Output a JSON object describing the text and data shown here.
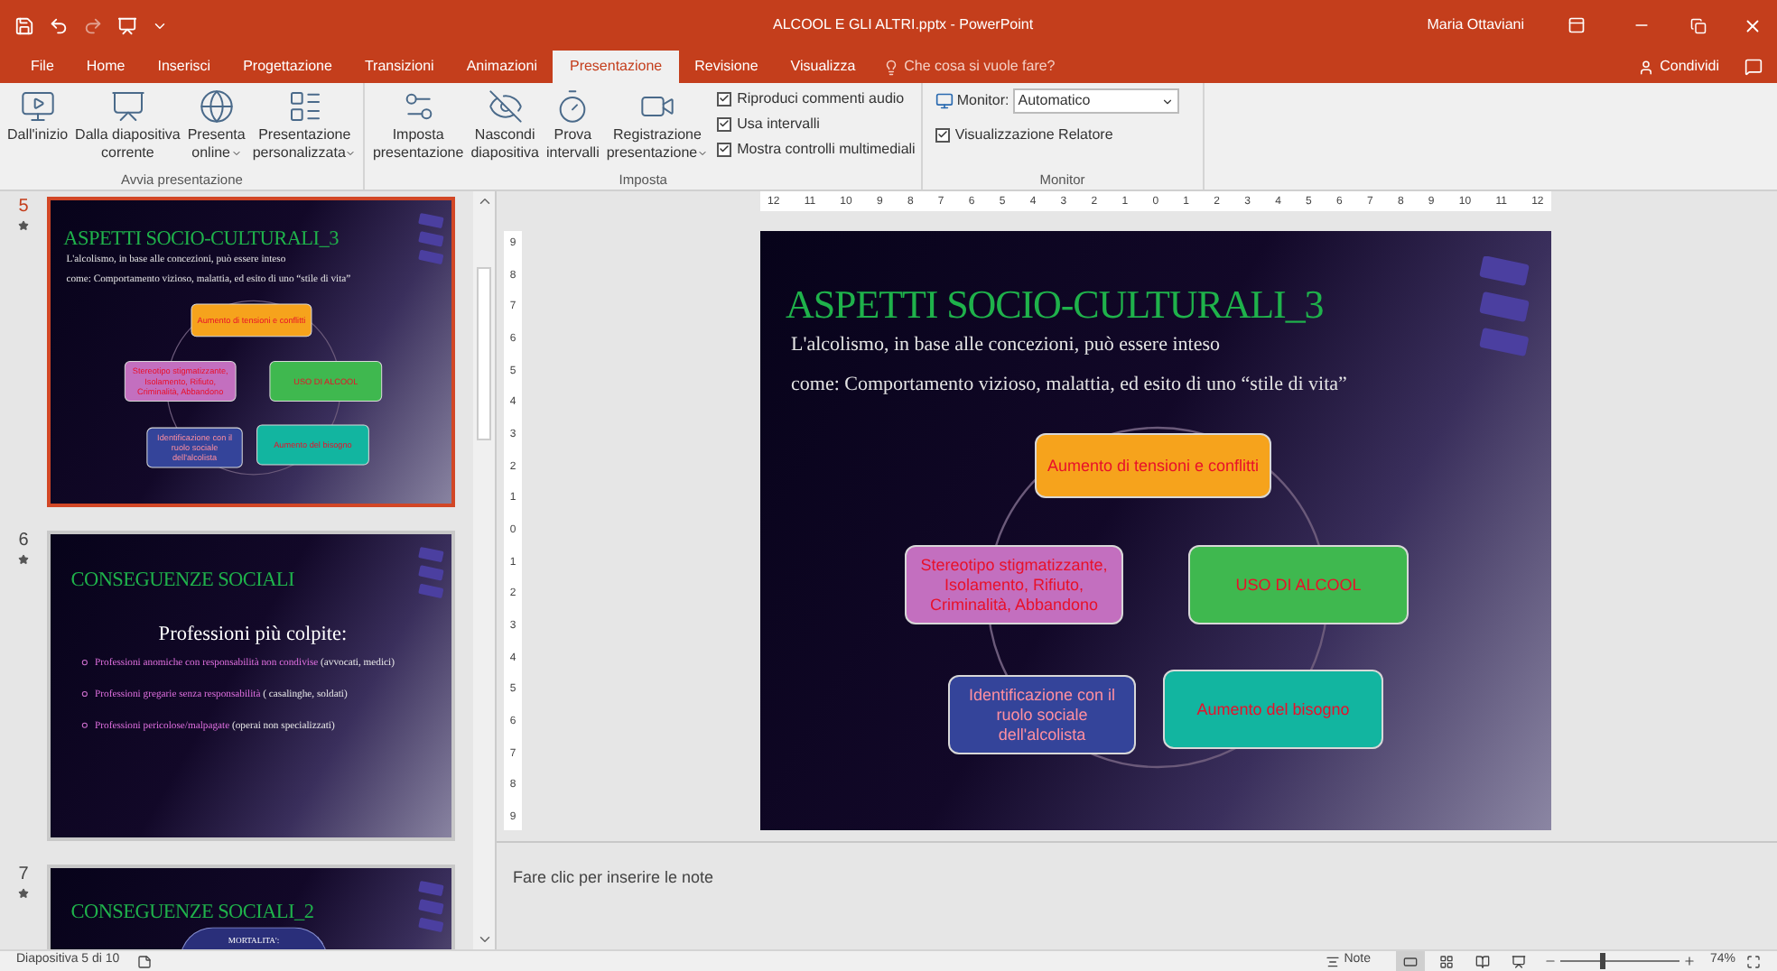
{
  "window": {
    "title": "ALCOOL E GLI ALTRI.pptx - PowerPoint",
    "user": "Maria Ottaviani"
  },
  "tabs": [
    {
      "label": "File",
      "selected": false
    },
    {
      "label": "Home",
      "selected": false
    },
    {
      "label": "Inserisci",
      "selected": false
    },
    {
      "label": "Progettazione",
      "selected": false
    },
    {
      "label": "Transizioni",
      "selected": false
    },
    {
      "label": "Animazioni",
      "selected": false
    },
    {
      "label": "Presentazione",
      "selected": true
    },
    {
      "label": "Revisione",
      "selected": false
    },
    {
      "label": "Visualizza",
      "selected": false
    }
  ],
  "search": {
    "placeholder": "Che cosa si vuole fare?"
  },
  "share": {
    "label": "Condividi"
  },
  "ribbon": {
    "groups": [
      {
        "label": "Avvia presentazione",
        "items": [
          {
            "kind": "large",
            "lines": [
              "Dall'inizio"
            ],
            "dropdown": false
          },
          {
            "kind": "large",
            "lines": [
              "Dalla diapositiva",
              "corrente"
            ],
            "dropdown": false
          },
          {
            "kind": "large",
            "lines": [
              "Presenta",
              "online"
            ],
            "dropdown": true
          },
          {
            "kind": "large",
            "lines": [
              "Presentazione",
              "personalizzata"
            ],
            "dropdown": true
          }
        ]
      },
      {
        "label": "Imposta",
        "items": [
          {
            "kind": "large",
            "lines": [
              "Imposta",
              "presentazione"
            ],
            "dropdown": false
          },
          {
            "kind": "large",
            "lines": [
              "Nascondi",
              "diapositiva"
            ],
            "dropdown": false
          },
          {
            "kind": "large",
            "lines": [
              "Prova",
              "intervalli"
            ],
            "dropdown": false
          },
          {
            "kind": "large",
            "lines": [
              "Registrazione",
              "presentazione"
            ],
            "dropdown": true
          },
          {
            "kind": "checks",
            "checks": [
              {
                "label": "Riproduci commenti audio",
                "checked": true
              },
              {
                "label": "Usa intervalli",
                "checked": true
              },
              {
                "label": "Mostra controlli multimediali",
                "checked": true
              }
            ]
          }
        ]
      },
      {
        "label": "Monitor",
        "items": [
          {
            "kind": "monitor",
            "label": "Monitor:",
            "value": "Automatico",
            "checks": [
              {
                "label": "Visualizzazione Relatore",
                "checked": true
              }
            ]
          }
        ]
      }
    ]
  },
  "slides_panel": {
    "slides": [
      {
        "number": "5",
        "selected": true,
        "kind": "diagram",
        "title": "ASPETTI SOCIO-CULTURALI_3",
        "lines": [
          "L'alcolismo, in base alle concezioni, può essere inteso",
          "come: Comportamento vizioso, malattia, ed esito di uno “stile di vita”"
        ],
        "nodes": [
          {
            "text": "Aumento di tensioni e conflitti",
            "color": "#f6a31c"
          },
          {
            "text": "Stereotipo stigmatizzante, Isolamento, Rifiuto, Criminalità, Abbandono",
            "color": "#c36fbf"
          },
          {
            "text": "USO DI ALCOOL",
            "color": "#3fb84f"
          },
          {
            "text": "Identificazione con il ruolo sociale dell'alcolista",
            "color": "#34449a"
          },
          {
            "text": "Aumento del bisogno",
            "color": "#12b5a0"
          }
        ]
      },
      {
        "number": "6",
        "selected": false,
        "kind": "bullets",
        "title": "CONSEGUENZE SOCIALI",
        "heading": "Professioni più colpite:",
        "bullets": [
          {
            "highlight": "Professioni anomiche con responsabilità non condivise",
            "rest": "(avvocati, medici)"
          },
          {
            "highlight": "Professioni gregarie senza responsabilità",
            "rest": "( casalinghe, soldati)"
          },
          {
            "highlight": "Professioni pericolose/malpagate",
            "rest": "(operai non specializzati)"
          }
        ]
      },
      {
        "number": "7",
        "selected": false,
        "kind": "ellipses",
        "title": "CONSEGUENZE SOCIALI_2",
        "bubble": "MORTALITA':"
      }
    ]
  },
  "ruler": {
    "horizontal": [
      "12",
      "11",
      "10",
      "9",
      "8",
      "7",
      "6",
      "5",
      "4",
      "3",
      "2",
      "1",
      "0",
      "1",
      "2",
      "3",
      "4",
      "5",
      "6",
      "7",
      "8",
      "9",
      "10",
      "11",
      "12"
    ],
    "vertical": [
      "9",
      "8",
      "7",
      "6",
      "5",
      "4",
      "3",
      "2",
      "1",
      "0",
      "1",
      "2",
      "3",
      "4",
      "5",
      "6",
      "7",
      "8",
      "9"
    ]
  },
  "slide": {
    "kind": "diagram",
    "title": "ASPETTI SOCIO-CULTURALI_3",
    "lines": [
      "L'alcolismo, in base alle concezioni, può essere inteso",
      "come: Comportamento vizioso, malattia, ed esito di uno “stile di vita”"
    ],
    "nodes": [
      {
        "text": "Aumento di tensioni e conflitti",
        "color": "#f6a31c"
      },
      {
        "text": "Stereotipo stigmatizzante, Isolamento, Rifiuto, Criminalità, Abbandono",
        "color": "#c36fbf"
      },
      {
        "text": "USO DI ALCOOL",
        "color": "#3fb84f"
      },
      {
        "text": "Identificazione con il ruolo sociale dell'alcolista",
        "color": "#34449a"
      },
      {
        "text": "Aumento del bisogno",
        "color": "#12b5a0"
      }
    ]
  },
  "notes": {
    "placeholder": "Fare clic per inserire le note"
  },
  "status_bar": {
    "slide_info": "Diapositiva 5 di 10",
    "notes_label": "Note",
    "views": [
      {
        "selected": true
      },
      {
        "selected": false
      },
      {
        "selected": false
      },
      {
        "selected": false
      }
    ],
    "zoom": {
      "level": 0.35,
      "reading": "74%"
    }
  }
}
